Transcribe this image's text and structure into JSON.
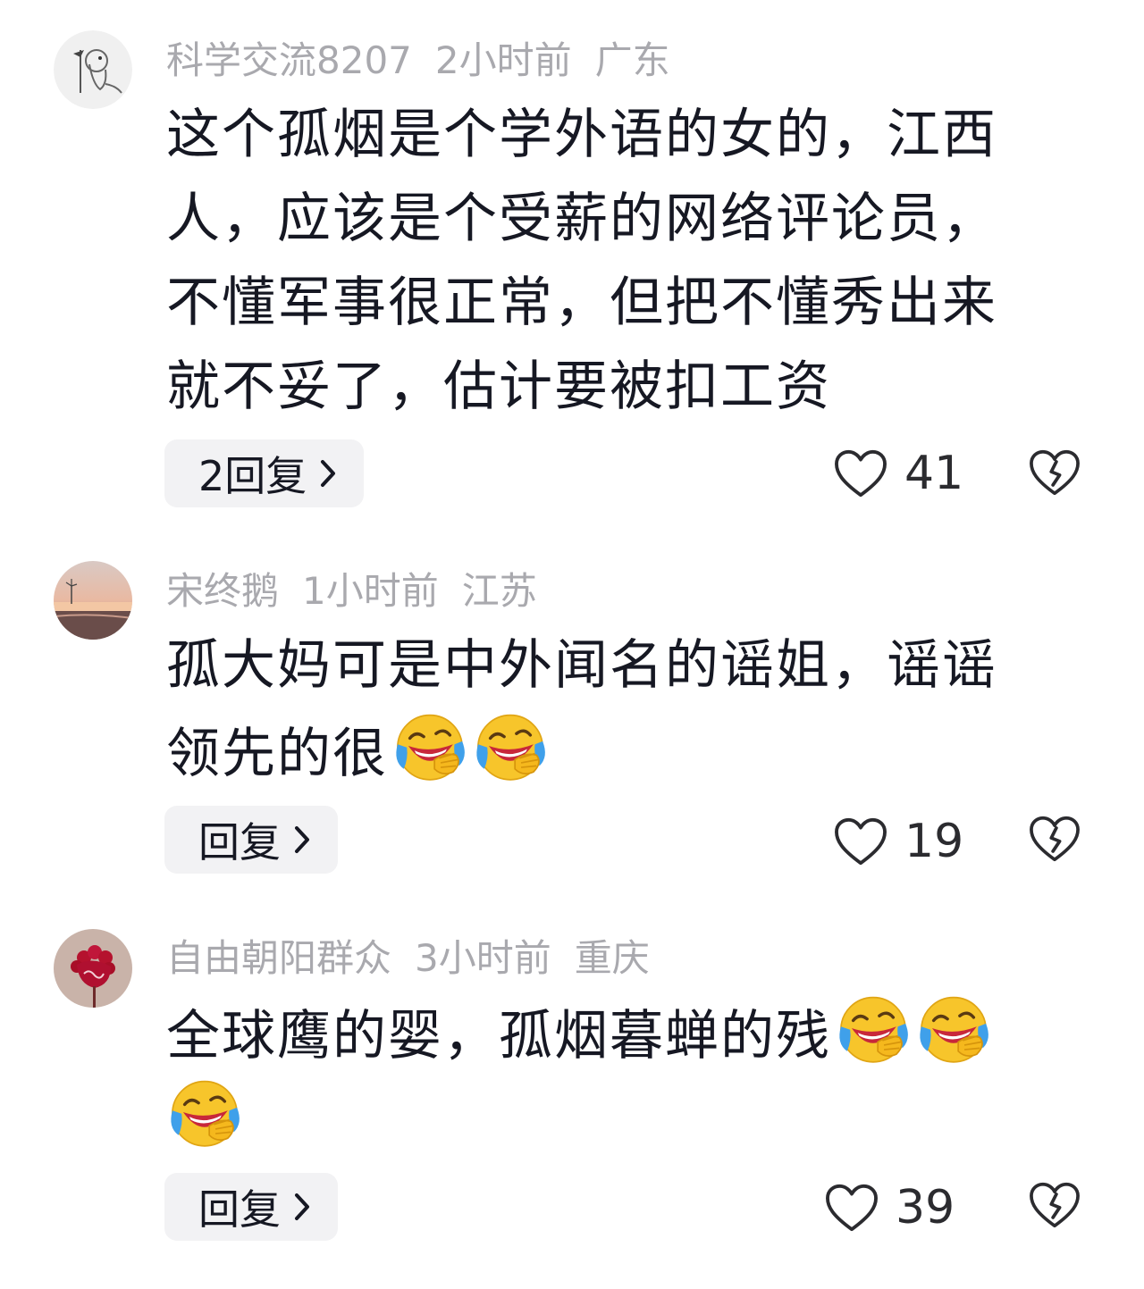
{
  "comments": [
    {
      "username": "科学交流8207",
      "time": "2小时前",
      "location": "广东",
      "lines": [
        "这个孤烟是个学外语的女的，江西",
        "人，应该是个受薪的网络评论员，",
        "不懂军事很正常，但把不懂秀出来",
        "就不妥了，估计要被扣工资"
      ],
      "reply_label": "2回复",
      "likes": "41",
      "avatar_icon": "bird-sketch-avatar",
      "emoji_count": 0
    },
    {
      "username": "宋终鹅",
      "time": "1小时前",
      "location": "江苏",
      "lines": [
        "孤大妈可是中外闻名的谣姐，谣谣",
        "领先的很"
      ],
      "reply_label": "回复",
      "likes": "19",
      "avatar_icon": "sunset-beach-avatar",
      "emoji_count": 2
    },
    {
      "username": "自由朝阳群众",
      "time": "3小时前",
      "location": "重庆",
      "lines": [
        "全球鹰的婴，孤烟暮蝉的残",
        ""
      ],
      "reply_label": "回复",
      "likes": "39",
      "avatar_icon": "red-flower-avatar",
      "emoji_count": 3
    }
  ],
  "colors": {
    "text": "#161823",
    "meta": "#a9a9ae",
    "button_bg": "#f2f2f4",
    "icon": "#2b2b2f"
  },
  "icons": [
    "heart-icon",
    "broken-heart-icon",
    "chevron-right-icon",
    "laughing-crying-emoji"
  ]
}
